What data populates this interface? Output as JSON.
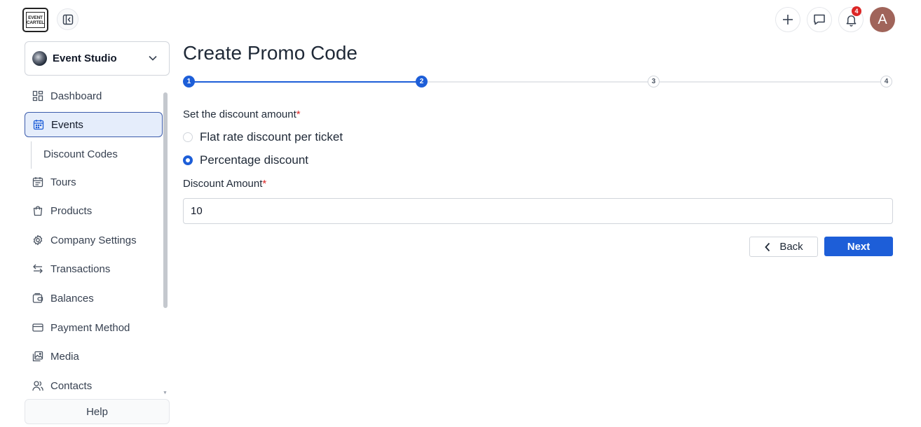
{
  "brand": {
    "logo_line1": "EVENT",
    "logo_line2": "CARTEL"
  },
  "header": {
    "notification_count": "4",
    "avatar_initial": "A"
  },
  "sidebar": {
    "org_name": "Event Studio",
    "items": [
      {
        "label": "Dashboard",
        "icon": "dashboard-icon"
      },
      {
        "label": "Events",
        "icon": "calendar-icon",
        "active": true
      },
      {
        "label": "Tours",
        "icon": "calendar-list-icon"
      },
      {
        "label": "Products",
        "icon": "shopping-bag-icon"
      },
      {
        "label": "Company Settings",
        "icon": "gear-icon"
      },
      {
        "label": "Transactions",
        "icon": "arrows-exchange-icon"
      },
      {
        "label": "Balances",
        "icon": "wallet-icon"
      },
      {
        "label": "Payment Method",
        "icon": "credit-card-icon"
      },
      {
        "label": "Media",
        "icon": "images-icon"
      },
      {
        "label": "Contacts",
        "icon": "users-icon"
      }
    ],
    "sub_item": "Discount Codes",
    "help": "Help"
  },
  "main": {
    "title": "Create Promo Code",
    "steps": [
      {
        "number": "1",
        "state": "done"
      },
      {
        "number": "2",
        "state": "current"
      },
      {
        "number": "3",
        "state": "todo"
      },
      {
        "number": "4",
        "state": "todo"
      }
    ],
    "discount_type_label": "Set the discount amount",
    "options": [
      {
        "label": "Flat rate discount per ticket",
        "selected": false
      },
      {
        "label": "Percentage discount",
        "selected": true
      }
    ],
    "amount_label": "Discount Amount",
    "amount_value": "10",
    "required_mark": "*",
    "back_label": "Back",
    "next_label": "Next"
  },
  "colors": {
    "accent": "#1d5ed8",
    "required": "#dc2626",
    "active_bg": "#e5edfb"
  }
}
